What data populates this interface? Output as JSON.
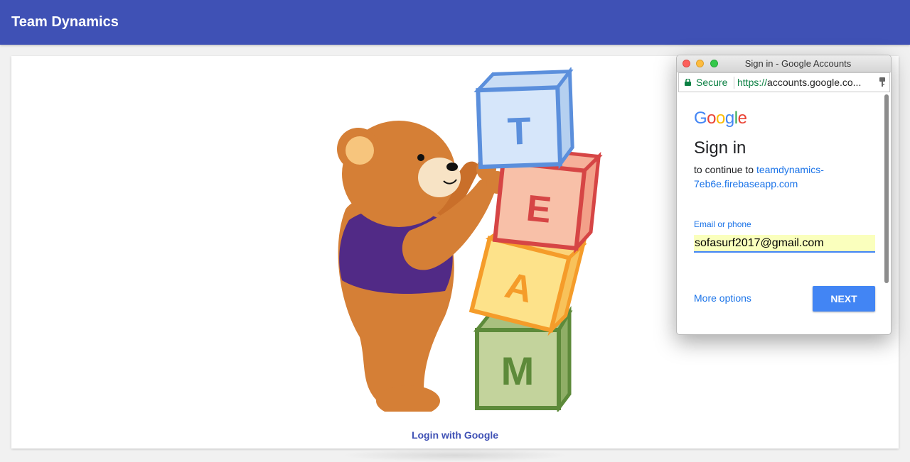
{
  "app": {
    "title": "Team Dynamics"
  },
  "main": {
    "login_label": "Login with Google",
    "blocks": [
      "T",
      "E",
      "A",
      "M"
    ]
  },
  "popup": {
    "window_title": "Sign in - Google Accounts",
    "secure_label": "Secure",
    "url_scheme": "https://",
    "url_rest": "accounts.google.co...",
    "google_logo": [
      "G",
      "o",
      "o",
      "g",
      "l",
      "e"
    ],
    "heading": "Sign in",
    "continue_prefix": "to continue to",
    "continue_link": "teamdynamics-7eb6e.firebaseapp.com",
    "field_label": "Email or phone",
    "email_value": "sofasurf2017@gmail.com",
    "more_options": "More options",
    "next_label": "NEXT"
  },
  "colors": {
    "appbar": "#3f51b5",
    "google_blue": "#4285f4",
    "link_blue": "#1a73e8",
    "secure_green": "#0b8043",
    "bear": "#d57f36",
    "shirt": "#512a86"
  },
  "icons": [
    "lock-icon",
    "key-icon",
    "close-icon",
    "minimize-icon",
    "maximize-icon"
  ]
}
